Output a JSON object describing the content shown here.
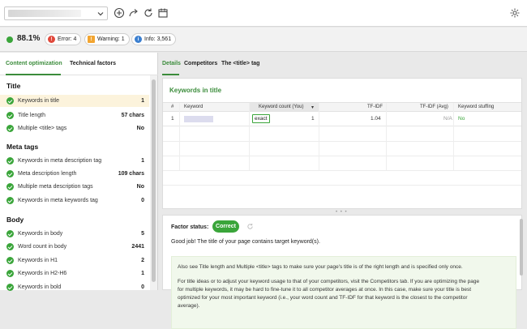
{
  "toolbar": {
    "url_value": "",
    "icons": [
      "add-icon",
      "share-icon",
      "refresh-icon",
      "calendar-icon",
      "gear-icon"
    ]
  },
  "status": {
    "score": "88.1%",
    "error_label": "Error: 4",
    "warning_label": "Warning: 1",
    "info_label": "Info: 3,561",
    "colors": {
      "ok": "#3aa53a",
      "error": "#e0483b",
      "warning": "#f2a531",
      "info": "#3b7fd0"
    }
  },
  "left_tabs": [
    "Content optimization",
    "Technical factors"
  ],
  "sections": [
    {
      "title": "Title",
      "rows": [
        {
          "label": "Keywords in title",
          "value": "1",
          "selected": true
        },
        {
          "label": "Title length",
          "value": "57 chars"
        },
        {
          "label": "Multiple <title> tags",
          "value": "No"
        }
      ]
    },
    {
      "title": "Meta tags",
      "rows": [
        {
          "label": "Keywords in meta description tag",
          "value": "1"
        },
        {
          "label": "Meta description length",
          "value": "109 chars"
        },
        {
          "label": "Multiple meta description tags",
          "value": "No"
        },
        {
          "label": "Keywords in meta keywords tag",
          "value": "0"
        }
      ]
    },
    {
      "title": "Body",
      "rows": [
        {
          "label": "Keywords in body",
          "value": "5"
        },
        {
          "label": "Word count in body",
          "value": "2441"
        },
        {
          "label": "Keywords in H1",
          "value": "2"
        },
        {
          "label": "Keywords in H2-H6",
          "value": "1"
        },
        {
          "label": "Keywords in bold",
          "value": "0"
        }
      ]
    }
  ],
  "right_tabs": [
    "Details",
    "Competitors",
    "The <title> tag"
  ],
  "keywords_card": {
    "title": "Keywords in title",
    "columns": [
      "#",
      "Keyword",
      "Keyword count (You)",
      "TF-IDF",
      "TF-IDF (Avg)",
      "Keyword stuffing"
    ],
    "rows": [
      {
        "num": "1",
        "match": "exact",
        "count": "1",
        "tfidf": "1.04",
        "tfidf_avg": "N/A",
        "stuffing": "No"
      }
    ]
  },
  "factor": {
    "status_label": "Factor status:",
    "status_value": "Correct",
    "message": "Good job! The title of your page contains target keyword(s).",
    "tip_lines": [
      "Also see Title length and Multiple <title> tags to make sure your page's title is of the right length and is specified only once.",
      "For title ideas or to adjust your keyword usage to that of your competitors, visit the Competitors tab. If you are optimizing the page",
      "for multiple keywords, it may be hard to fine-tune it to all competitor averages at once. In this case, make sure your title is best",
      "optimized for your most important keyword (i.e., your word count and TF-IDF for that keyword is the closest to the competitor",
      "average)."
    ]
  }
}
